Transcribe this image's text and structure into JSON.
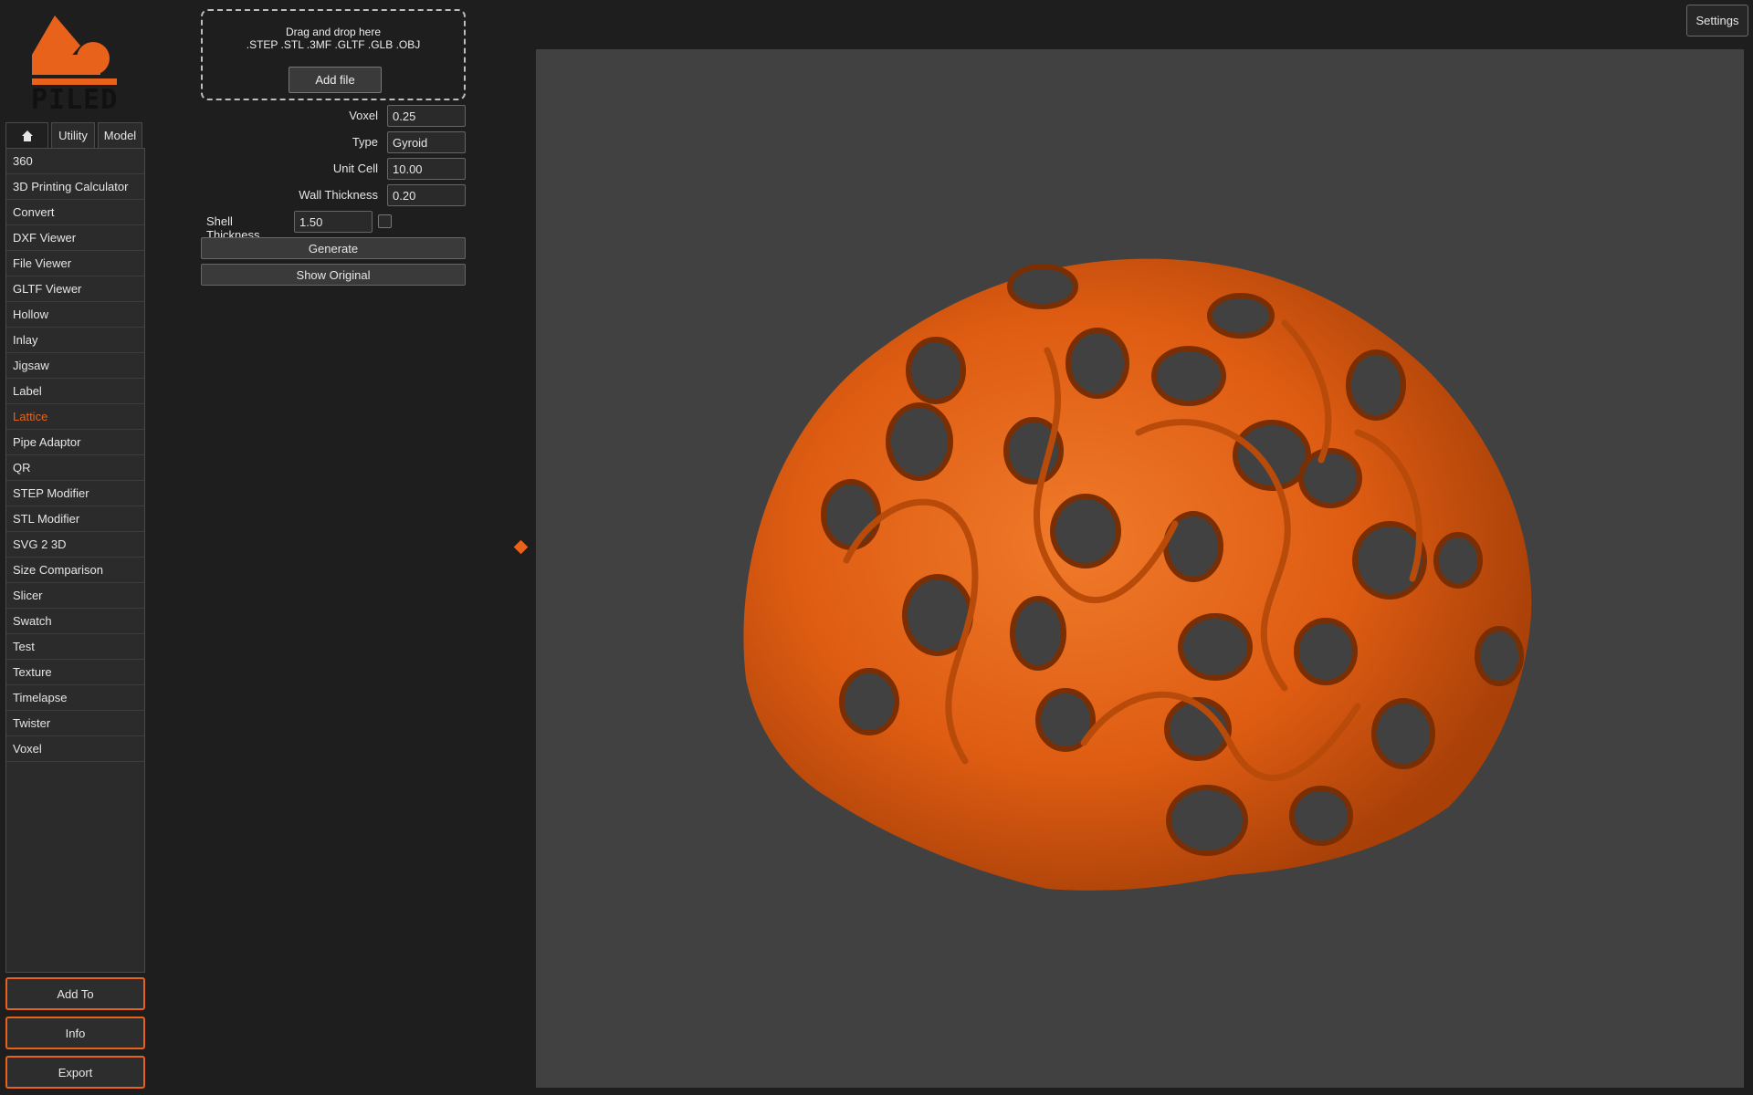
{
  "app": {
    "logo_text": "PILED",
    "accent_color": "#e8621b"
  },
  "tabs": [
    {
      "label": "",
      "icon": "home-icon"
    },
    {
      "label": "Utility"
    },
    {
      "label": "Model"
    }
  ],
  "tools": [
    "360",
    "3D Printing Calculator",
    "Convert",
    "DXF Viewer",
    "File Viewer",
    "GLTF Viewer",
    "Hollow",
    "Inlay",
    "Jigsaw",
    "Label",
    "Lattice",
    "Pipe Adaptor",
    "QR",
    "STEP Modifier",
    "STL Modifier",
    "SVG 2 3D",
    "Size Comparison",
    "Slicer",
    "Swatch",
    "Test",
    "Texture",
    "Timelapse",
    "Twister",
    "Voxel"
  ],
  "active_tool": "Lattice",
  "sidebar_buttons": {
    "add_to": "Add To",
    "info": "Info",
    "export": "Export"
  },
  "dropzone": {
    "line1": "Drag and drop here",
    "line2": ".STEP .STL .3MF .GLTF .GLB .OBJ",
    "add_file": "Add file"
  },
  "form": {
    "voxel_label": "Voxel",
    "voxel_value": "0.25",
    "type_label": "Type",
    "type_value": "Gyroid",
    "unit_cell_label": "Unit Cell",
    "unit_cell_value": "10.00",
    "wall_thickness_label": "Wall Thickness",
    "wall_thickness_value": "0.20",
    "shell_thickness_label": "Shell Thickness",
    "shell_thickness_value": "1.50",
    "shell_enabled": false,
    "generate": "Generate",
    "show_original": "Show Original"
  },
  "settings_label": "Settings",
  "viewport": {
    "background_color": "#414141",
    "model": "orange gyroid lattice sphere",
    "model_color": "#e8621b"
  }
}
